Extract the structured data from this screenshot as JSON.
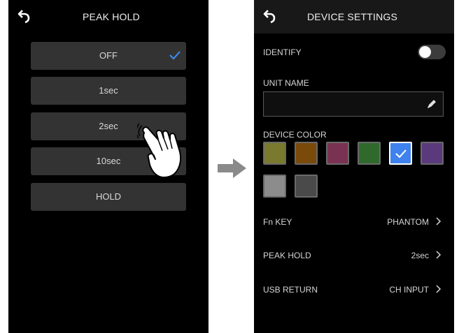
{
  "left_screen": {
    "title": "PEAK HOLD",
    "options": [
      "OFF",
      "1sec",
      "2sec",
      "10sec",
      "HOLD"
    ],
    "checked_option": "OFF"
  },
  "right_screen": {
    "title": "DEVICE SETTINGS",
    "identify": {
      "label": "IDENTIFY",
      "on": false
    },
    "unit_name": {
      "label": "UNIT NAME",
      "value": ""
    },
    "device_color": {
      "label": "DEVICE COLOR",
      "colors": [
        "#7a7a2e",
        "#7a4a0a",
        "#7a3252",
        "#2f6a2c",
        "#3f82ee",
        "#5a3a7c",
        "#8c8c8c",
        "#4a4a4a"
      ],
      "selected_index": 4
    },
    "settings": [
      {
        "label": "Fn KEY",
        "value": "PHANTOM"
      },
      {
        "label": "PEAK HOLD",
        "value": "2sec"
      },
      {
        "label": "USB RETURN",
        "value": "CH INPUT"
      }
    ]
  },
  "colors": {
    "accent": "#3d8ff5",
    "background": "#000000",
    "button": "#333333"
  }
}
